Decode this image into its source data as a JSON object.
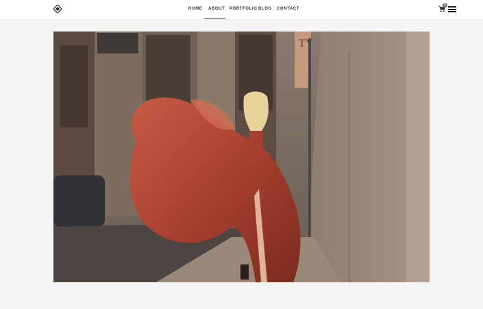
{
  "nav": {
    "items": [
      {
        "label": "HOME"
      },
      {
        "label": "ABOUT"
      },
      {
        "label": "PORTFOLIO"
      },
      {
        "label": "BLOG"
      },
      {
        "label": "CONTACT"
      }
    ],
    "active": "ABOUT"
  },
  "header": {
    "logo_icon": "diamond-logo-icon",
    "cart_icon": "shopping-cart-icon",
    "cart_count": "0",
    "menu_icon": "hamburger-menu-icon"
  },
  "hero": {
    "image_description_icon": "fashion-photo",
    "sign_text": "TY"
  },
  "colors": {
    "header_bg": "#ffffff",
    "page_bg": "#f5f5f6",
    "dress": "#b0493a",
    "text": "#333333"
  }
}
